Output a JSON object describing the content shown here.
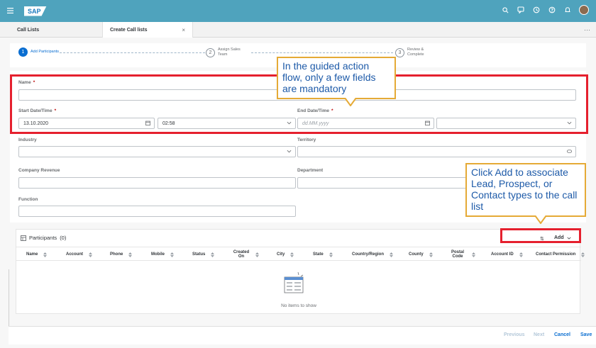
{
  "shell": {
    "logo": "SAP"
  },
  "tabs": [
    {
      "label": "Call Lists"
    },
    {
      "label": "Create Call lists",
      "close": "×"
    }
  ],
  "more": "···",
  "stepper": [
    {
      "num": "1",
      "label": "Add Participants"
    },
    {
      "num": "2",
      "label": "Assign Sales Team"
    },
    {
      "num": "3",
      "label": "Review & Complete"
    }
  ],
  "form": {
    "name_label": "Name",
    "required_mark": "*",
    "start_label": "Start Date/Time",
    "start_date": "13.10.2020",
    "start_time": "02:58",
    "end_label": "End Date/Time",
    "end_date_placeholder": "dd.MM.yyyy",
    "industry_label": "Industry",
    "territory_label": "Territory",
    "revenue_label": "Company Revenue",
    "department_label": "Department",
    "function_label": "Function"
  },
  "participants": {
    "title": "Participants",
    "count": "(0)",
    "add_label": "Add",
    "sort_glyph": "⇅",
    "columns": [
      "Name",
      "Account",
      "Phone",
      "Mobile",
      "Status",
      "Created On",
      "City",
      "State",
      "Country/Region",
      "County",
      "Postal Code",
      "Account ID",
      "Contact Permission"
    ],
    "empty_text": "No items to show"
  },
  "footer": {
    "previous": "Previous",
    "next": "Next",
    "cancel": "Cancel",
    "save": "Save"
  },
  "callouts": {
    "mandatory": "In the guided action flow, only a few fields are mandatory",
    "add": "Click Add to associate Lead, Prospect, or Contact types to the call list"
  }
}
